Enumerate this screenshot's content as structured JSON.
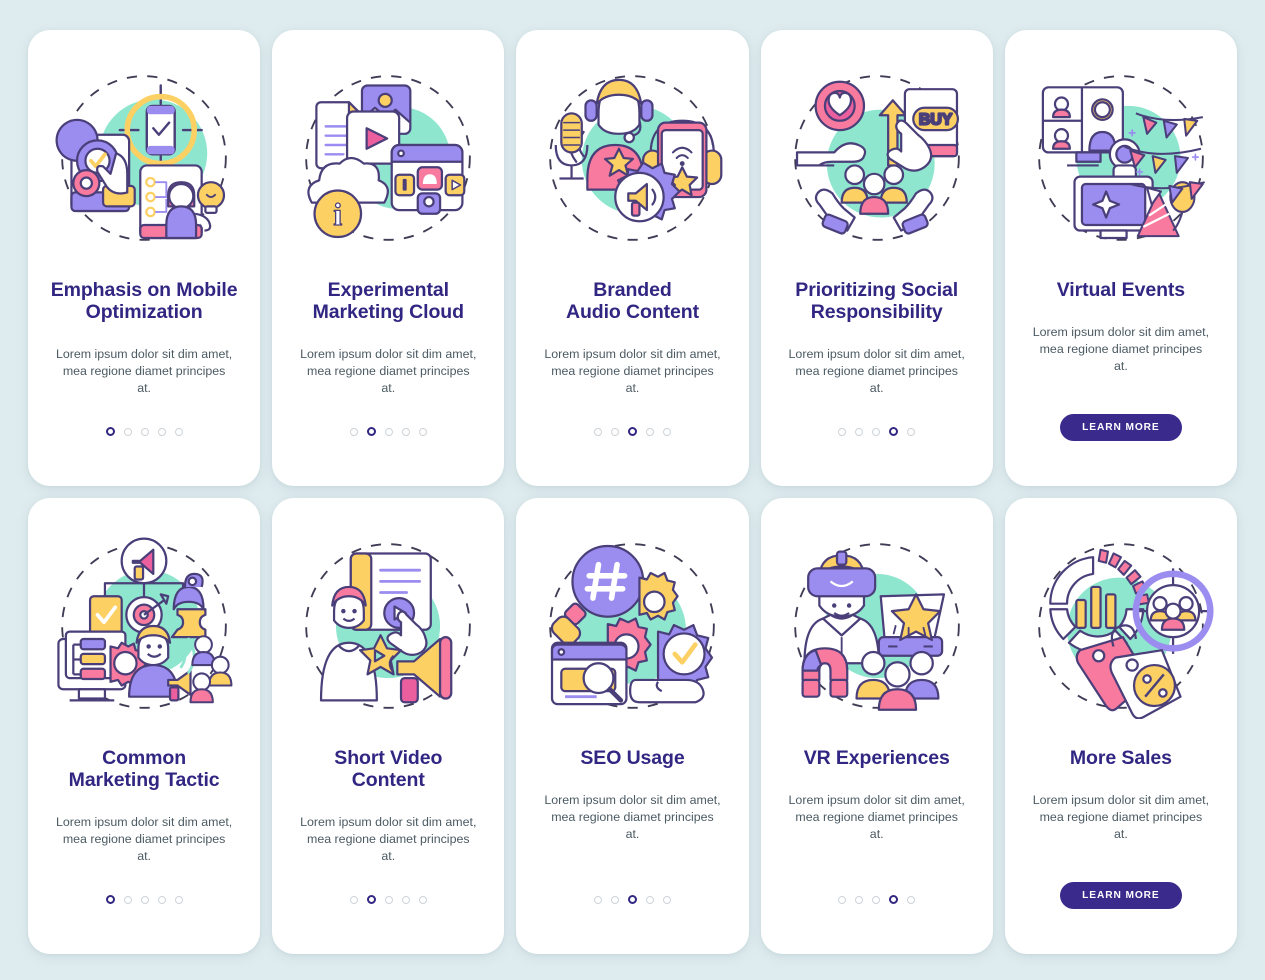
{
  "page": {
    "background_color": "#dfecef",
    "card_background": "#ffffff",
    "title_color": "#312783",
    "body_text_color": "#4b5a63",
    "button_color": "#3a2a8c",
    "accent_mint": "#8ee6cf",
    "accent_purple": "#9b8cf0",
    "accent_yellow": "#fcd063",
    "accent_pink": "#f87a9e",
    "accent_magenta": "#ec5f9e",
    "outline_color": "#4b3f7a"
  },
  "common": {
    "description": "Lorem ipsum dolor sit dim amet, mea regione diamet principes at.",
    "learn_more_label": "LEARN MORE",
    "dot_count": 5
  },
  "cards": [
    {
      "title": "Emphasis on Mobile\nOptimization",
      "description": "Lorem ipsum dolor sit dim amet, mea regione diamet principes at.",
      "active_dot": 1,
      "has_button": false,
      "illustration": "mobile-optimization-illustration"
    },
    {
      "title": "Experimental\nMarketing Cloud",
      "description": "Lorem ipsum dolor sit dim amet, mea regione diamet principes at.",
      "active_dot": 2,
      "has_button": false,
      "illustration": "marketing-cloud-illustration"
    },
    {
      "title": "Branded\nAudio Content",
      "description": "Lorem ipsum dolor sit dim amet, mea regione diamet principes at.",
      "active_dot": 3,
      "has_button": false,
      "illustration": "branded-audio-illustration"
    },
    {
      "title": "Prioritizing Social\nResponsibility",
      "description": "Lorem ipsum dolor sit dim amet, mea regione diamet principes at.",
      "active_dot": 4,
      "has_button": false,
      "illustration": "social-responsibility-illustration",
      "illustration_text": "BUY"
    },
    {
      "title": "Virtual Events",
      "description": "Lorem ipsum dolor sit dim amet, mea regione diamet principes at.",
      "active_dot": 0,
      "has_button": true,
      "button_label": "LEARN MORE",
      "illustration": "virtual-events-illustration"
    },
    {
      "title": "Common\nMarketing Tactic",
      "description": "Lorem ipsum dolor sit dim amet, mea regione diamet principes at.",
      "active_dot": 1,
      "has_button": false,
      "illustration": "marketing-tactic-illustration"
    },
    {
      "title": "Short Video\nContent",
      "description": "Lorem ipsum dolor sit dim amet, mea regione diamet principes at.",
      "active_dot": 2,
      "has_button": false,
      "illustration": "short-video-illustration"
    },
    {
      "title": "SEO Usage",
      "description": "Lorem ipsum dolor sit dim amet, mea regione diamet principes at.",
      "active_dot": 3,
      "has_button": false,
      "illustration": "seo-usage-illustration"
    },
    {
      "title": "VR Experiences",
      "description": "Lorem ipsum dolor sit dim amet, mea regione diamet principes at.",
      "active_dot": 4,
      "has_button": false,
      "illustration": "vr-experiences-illustration"
    },
    {
      "title": "More Sales",
      "description": "Lorem ipsum dolor sit dim amet, mea regione diamet principes at.",
      "active_dot": 0,
      "has_button": true,
      "button_label": "LEARN MORE",
      "illustration": "more-sales-illustration"
    }
  ]
}
